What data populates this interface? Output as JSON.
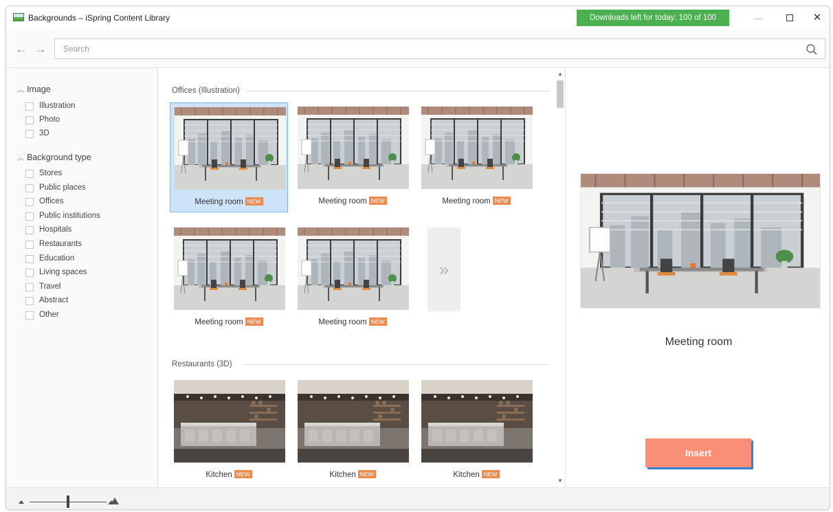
{
  "window": {
    "title": "Backgrounds – iSpring Content Library"
  },
  "downloads": {
    "text": "Downloads left for today: 100 of 100"
  },
  "search": {
    "placeholder": "Search",
    "value": ""
  },
  "filters": {
    "image": {
      "heading": "Image",
      "items": [
        "Illustration",
        "Photo",
        "3D"
      ]
    },
    "background_type": {
      "heading": "Background type",
      "items": [
        "Stores",
        "Public places",
        "Offices",
        "Public institutions",
        "Hospitals",
        "Restaurants",
        "Education",
        "Living spaces",
        "Travel",
        "Abstract",
        "Other"
      ]
    }
  },
  "sections": [
    {
      "title": "Offices (Illustration)",
      "items": [
        {
          "label": "Meeting room",
          "badge": "NEW"
        },
        {
          "label": "Meeting room",
          "badge": "NEW"
        },
        {
          "label": "Meeting room",
          "badge": "NEW"
        },
        {
          "label": "Meeting room",
          "badge": "NEW"
        },
        {
          "label": "Meeting room",
          "badge": "NEW"
        }
      ],
      "more_symbol": "»"
    },
    {
      "title": "Restaurants (3D)",
      "items": [
        {
          "label": "Kitchen",
          "badge": "NEW"
        },
        {
          "label": "Kitchen",
          "badge": "NEW"
        },
        {
          "label": "Kitchen",
          "badge": "NEW"
        }
      ]
    }
  ],
  "preview": {
    "name": "Meeting room",
    "insert_label": "Insert"
  },
  "colors": {
    "downloads_bg": "#4caf50",
    "selection_bg": "#cde3f7",
    "new_badge": "#f08a4b",
    "insert_button": "#f98f76",
    "insert_shadow": "#2c83d3"
  }
}
